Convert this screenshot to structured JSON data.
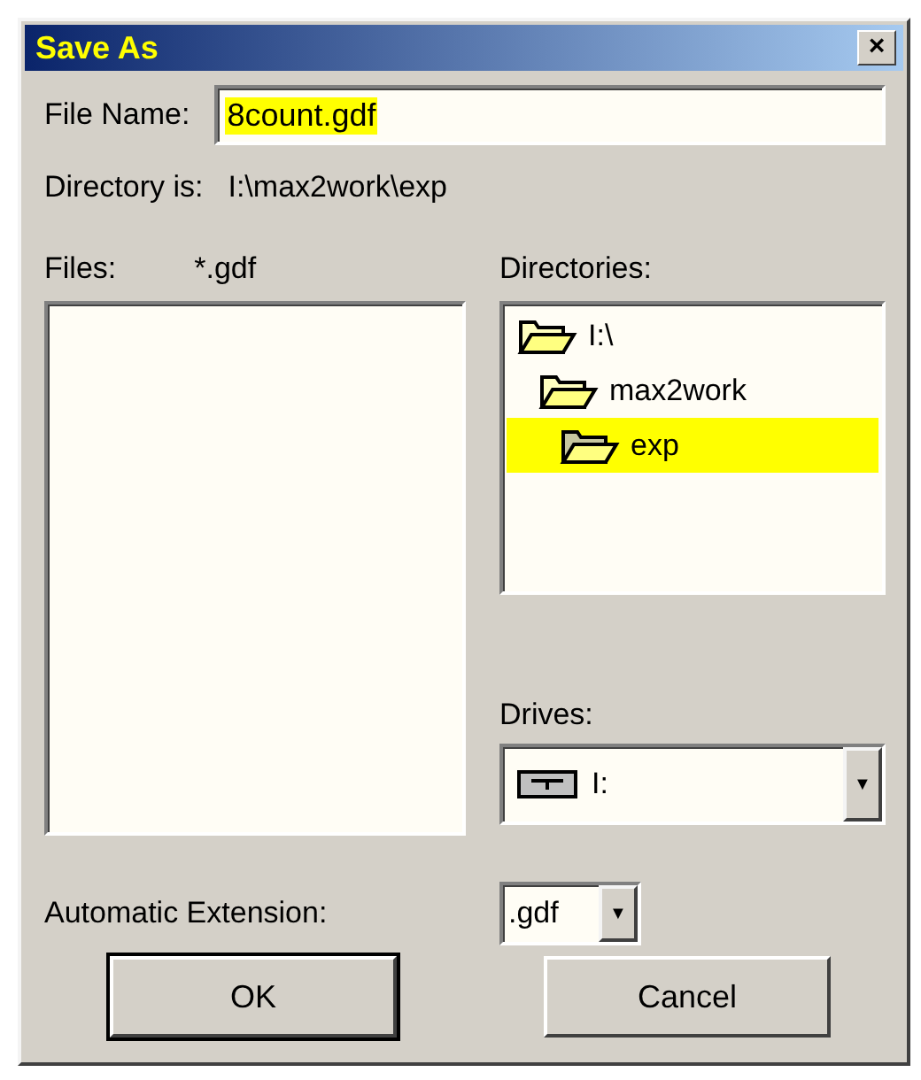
{
  "window": {
    "title": "Save As",
    "close": "×"
  },
  "file_name": {
    "label": "File Name:",
    "value": "8count.gdf",
    "highlighted": true
  },
  "directory": {
    "label": "Directory is:",
    "path": "I:\\max2work\\exp"
  },
  "files": {
    "label": "Files:",
    "filter": "*.gdf"
  },
  "directories": {
    "label": "Directories:",
    "items": [
      {
        "name": "I:\\",
        "selected": false,
        "children": [
          {
            "name": "max2work",
            "selected": false,
            "children": [
              {
                "name": "exp",
                "selected": true
              }
            ]
          }
        ]
      }
    ]
  },
  "drives": {
    "label": "Drives:",
    "value": "I:",
    "arrow": "▼"
  },
  "extension": {
    "label": "Automatic Extension:",
    "value": ".gdf",
    "arrow": "▼"
  },
  "buttons": [
    {
      "label": "OK",
      "default": true
    },
    {
      "label": "Cancel",
      "default": false
    }
  ]
}
